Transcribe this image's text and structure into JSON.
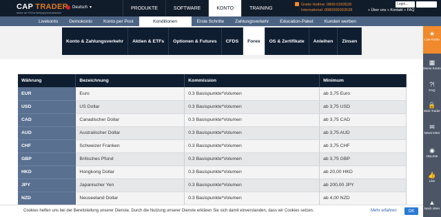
{
  "header": {
    "logo_main_a": "CAP",
    "logo_main_b": " TRADER",
    "logo_sub": "Marke der FXFlat Wertpapierhandelsbank",
    "language": "Deutsch",
    "language_caret": "▾",
    "nav": [
      "PRODUKTE",
      "SOFTWARE",
      "KONTO",
      "TRAINING"
    ],
    "nav_active": "KONTO",
    "hotline": "Gratis Hotline: 0800-0393528",
    "international": "International: 0080000393528",
    "links": "» Über uns   » Kontakt   » FAQ",
    "login_placeholder": "Login..."
  },
  "subnav": [
    "Livekonto",
    "Demokonto",
    "Konto per Post",
    "Konditionen",
    "Erste Schritte",
    "Zahlungsverkehr",
    "Education-Paket",
    "Kunden werben"
  ],
  "tabs": [
    "Konto & Zahlungsverkehr",
    "Aktien & ETFs",
    "Optionen & Futures",
    "CFDS",
    "Forex",
    "OS & Zertifikate",
    "Anleihen",
    "Zinsen"
  ],
  "table": {
    "headers": [
      "Währung",
      "Bezeichnung",
      "Kommission",
      "Minimum"
    ],
    "rows": [
      {
        "code": "EUR",
        "name": "Euro",
        "commission": "0.3 Basispunkte*Volumen",
        "minimum": "ab 3,75 Euro"
      },
      {
        "code": "USD",
        "name": "US Dollar",
        "commission": "0.3 Basispunkte*Volumen",
        "minimum": "ab 3,75 USD"
      },
      {
        "code": "CAD",
        "name": "Canadischer Dollar",
        "commission": "0.3 Basispunkte*Volumen",
        "minimum": "ab 3,75 CAD"
      },
      {
        "code": "AUD",
        "name": "Australischer Dollar",
        "commission": "0.3 Basispunkte*Volumen",
        "minimum": "ab 3,75 AUD"
      },
      {
        "code": "CHF",
        "name": "Schweizer Franken",
        "commission": "0.3 Basispunkte*Volumen",
        "minimum": "ab 3,75 CHF"
      },
      {
        "code": "GBP",
        "name": "Britisches Pfund",
        "commission": "0.3 Basispunkte*Volumen",
        "minimum": "ab 3,75 GBP"
      },
      {
        "code": "HKD",
        "name": "Hongkong Dollar",
        "commission": "0.3 Basispunkte*Volumen",
        "minimum": "ab 20,00 HKD"
      },
      {
        "code": "JPY",
        "name": "Japanischer Yen",
        "commission": "0.3 Basispunkte*Volumen",
        "minimum": "ab 200,00 JPY"
      },
      {
        "code": "NZD",
        "name": "Neuseeland Dollar",
        "commission": "0.3 Basispunkte*Volumen",
        "minimum": "ab 4,00 NZD"
      }
    ]
  },
  "cookie": {
    "text": "Cookies helfen uns bei der Bereitstellung unserer Dienste. Durch die Nutzung unserer Dienste erklären Sie sich damit einverstanden, dass wir Cookies setzen.",
    "more": "Mehr erfahren",
    "ok": "OK"
  },
  "sidebar": [
    {
      "label": "Live Konto",
      "icon": "star-icon",
      "glyph": "★"
    },
    {
      "label": "Demo Konto",
      "icon": "chart-icon",
      "glyph": "▦"
    },
    {
      "label": "FAQ",
      "icon": "question-icon",
      "glyph": "?!"
    },
    {
      "label": "Web Trader",
      "icon": "lock-icon",
      "glyph": "🔒"
    },
    {
      "label": "News letter",
      "icon": "mail-icon",
      "glyph": "✉"
    },
    {
      "label": "ONLINE",
      "icon": "chat-icon",
      "glyph": "◉"
    },
    {
      "label": "Like",
      "icon": "thumbs-up-icon",
      "glyph": "👍"
    },
    {
      "label": "Nach oben",
      "icon": "arrow-up-icon",
      "glyph": "▲"
    }
  ],
  "colors": {
    "navy": "#0f1d30",
    "accent": "#f08a2d",
    "subnav": "#4c6484",
    "code_cell": "#5a7090"
  }
}
